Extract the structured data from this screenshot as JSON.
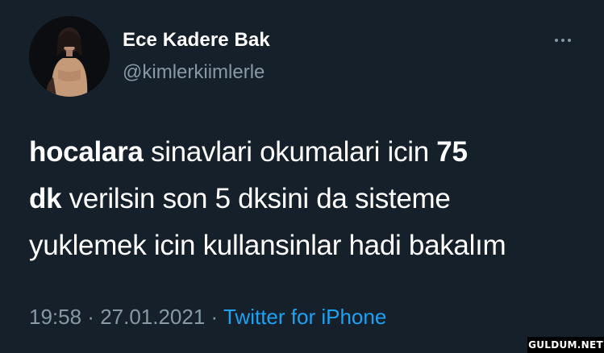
{
  "user": {
    "display_name": "Ece Kadere Bak",
    "handle": "@kimlerkiimlerle",
    "avatar_icon": "profile-photo"
  },
  "more_icon": "more-dots-icon",
  "tweet": {
    "line1_bold": "hocalara",
    "line1_rest": " sinavlari okumalari icin ",
    "line1_bold_end": "75",
    "line2_bold": "dk",
    "line2_rest": " verilsin son 5 dksini da sisteme",
    "line3": "yuklemek icin kullansinlar hadi bakalım"
  },
  "meta": {
    "time": "19:58",
    "sep1": " · ",
    "date": "27.01.2021",
    "sep2": " · ",
    "source": "Twitter for iPhone"
  },
  "watermark": "GULDUM.NET",
  "colors": {
    "background": "#15202b",
    "text": "#ffffff",
    "secondary": "#8899a6",
    "accent": "#1da1f2"
  }
}
